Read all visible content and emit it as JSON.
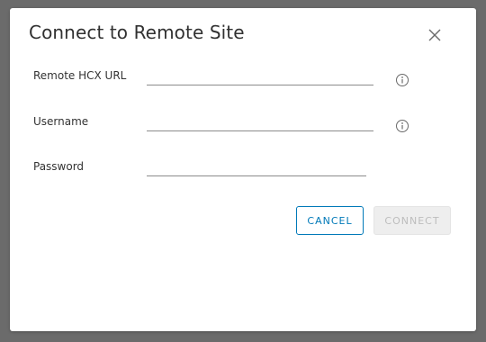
{
  "dialog": {
    "title": "Connect to Remote Site",
    "close_icon": "close-icon"
  },
  "form": {
    "fields": [
      {
        "label": "Remote HCX URL",
        "value": "",
        "placeholder": "",
        "has_info": true,
        "info_icon": "info-icon"
      },
      {
        "label": "Username",
        "value": "",
        "placeholder": "",
        "has_info": true,
        "info_icon": "info-icon"
      },
      {
        "label": "Password",
        "value": "",
        "placeholder": "",
        "has_info": false
      }
    ]
  },
  "actions": {
    "cancel_label": "CANCEL",
    "connect_label": "CONNECT",
    "connect_disabled": true
  },
  "colors": {
    "accent": "#0079b8",
    "overlay": "#6b6b6b",
    "disabled_bg": "#eeeeee",
    "disabled_text": "#bdbdbd"
  }
}
